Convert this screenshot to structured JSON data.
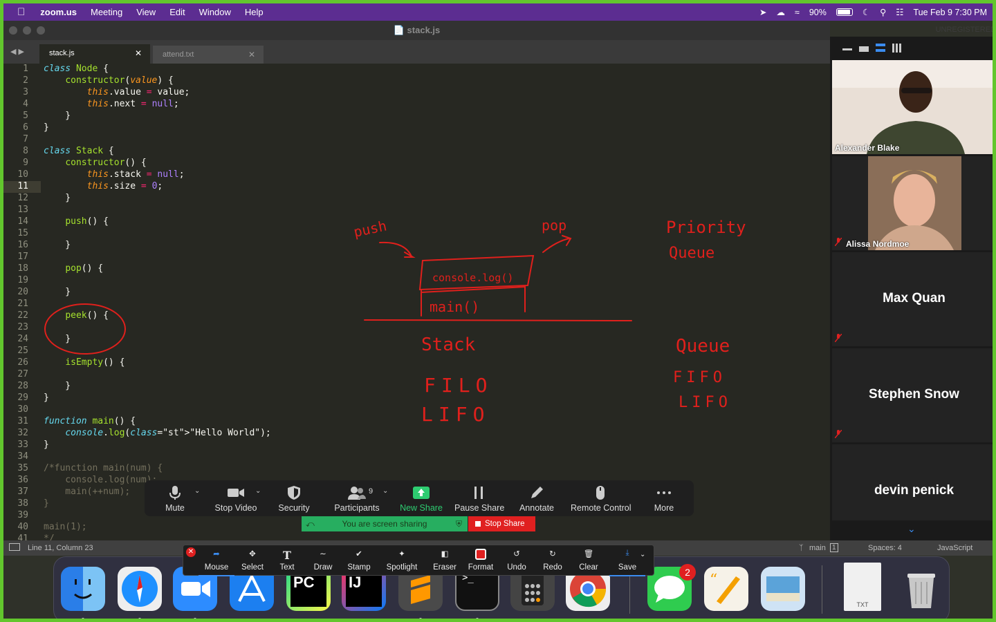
{
  "menubar": {
    "app": "zoom.us",
    "items": [
      "Meeting",
      "View",
      "Edit",
      "Window",
      "Help"
    ],
    "battery": "90%",
    "datetime": "Tue Feb 9  7:30 PM"
  },
  "window": {
    "title": "stack.js",
    "unregistered": "UNREGISTERED"
  },
  "tabs": [
    {
      "label": "stack.js",
      "active": true
    },
    {
      "label": "attend.txt",
      "active": false
    }
  ],
  "editor": {
    "line_numbers": [
      "1",
      "2",
      "3",
      "4",
      "5",
      "6",
      "7",
      "8",
      "9",
      "10",
      "11",
      "12",
      "13",
      "14",
      "15",
      "16",
      "17",
      "18",
      "19",
      "20",
      "21",
      "22",
      "23",
      "24",
      "25",
      "26",
      "27",
      "28",
      "29",
      "30",
      "31",
      "32",
      "33",
      "34",
      "35",
      "36",
      "37",
      "38",
      "39",
      "40",
      "41"
    ],
    "lines": [
      "class Node {",
      "    constructor(value) {",
      "        this.value = value;",
      "        this.next = null;",
      "    }",
      "}",
      "",
      "class Stack {",
      "    constructor() {",
      "        this.stack = null;",
      "        this.size = 0;",
      "    }",
      "",
      "    push() {",
      "",
      "    }",
      "",
      "    pop() {",
      "",
      "    }",
      "",
      "    peek() {",
      "",
      "    }",
      "",
      "    isEmpty() {",
      "",
      "    }",
      "}",
      "",
      "function main() {",
      "    console.log(\"Hello World\");",
      "}",
      "",
      "/*function main(num) {",
      "    console.log(num);",
      "    main(++num);",
      "}",
      "",
      "main(1);",
      "*/"
    ],
    "current_line": 11
  },
  "statusbar": {
    "position": "Line 11, Column 23",
    "branch": "main",
    "branch_count": "1",
    "spaces": "Spaces: 4",
    "syntax": "JavaScript"
  },
  "participants": [
    {
      "name": "Alexander Blake",
      "video": true,
      "muted": false
    },
    {
      "name": "Alissa Nordmoe",
      "video": true,
      "muted": true
    },
    {
      "name": "Max Quan",
      "video": false,
      "muted": true
    },
    {
      "name": "Stephen Snow",
      "video": false,
      "muted": true
    },
    {
      "name": "devin penick",
      "video": false,
      "muted": true
    }
  ],
  "zoom_toolbar": {
    "items": [
      {
        "key": "mute",
        "label": "Mute",
        "icon": "microphone-icon"
      },
      {
        "key": "video",
        "label": "Stop Video",
        "icon": "video-camera-icon"
      },
      {
        "key": "security",
        "label": "Security",
        "icon": "shield-icon"
      },
      {
        "key": "participants",
        "label": "Participants",
        "icon": "participants-icon",
        "count": "9"
      },
      {
        "key": "newshare",
        "label": "New Share",
        "icon": "share-up-arrow-icon",
        "accent": "#2ecc71"
      },
      {
        "key": "pause",
        "label": "Pause Share",
        "icon": "pause-icon"
      },
      {
        "key": "annotate",
        "label": "Annotate",
        "icon": "pencil-icon"
      },
      {
        "key": "remote",
        "label": "Remote Control",
        "icon": "mouse-icon"
      },
      {
        "key": "more",
        "label": "More",
        "icon": "more-dots-icon"
      }
    ]
  },
  "sharebar": {
    "status": "You are screen sharing",
    "stop": "Stop Share"
  },
  "annotation_toolbar": {
    "items": [
      "Mouse",
      "Select",
      "Text",
      "Draw",
      "Stamp",
      "Spotlight",
      "Eraser",
      "Format",
      "Undo",
      "Redo",
      "Clear",
      "Save"
    ],
    "active": "Mouse"
  },
  "whiteboard_text": {
    "push": "push",
    "pop": "pop",
    "box_top": "console.log()",
    "box_bottom": "main()",
    "stack": "Stack",
    "filo": "FILO",
    "lifo": "LIFO",
    "priority": "Priority",
    "queue_small": "Queue",
    "queue": "Queue",
    "fifo": "FIFO",
    "lifo2": "LIFO"
  },
  "dock": {
    "messages_badge": "2",
    "txt_label": "TXT",
    "apps": [
      "finder-icon",
      "safari-icon",
      "zoom-icon",
      "xcode-icon",
      "pycharm-icon",
      "intellij-icon",
      "sublime-text-icon",
      "terminal-icon",
      "calculator-icon",
      "chrome-icon",
      "messages-icon",
      "pages-icon",
      "preview-icon",
      "text-file-icon",
      "trash-icon"
    ]
  },
  "colors": {
    "accent_menubar": "#5c2d91",
    "frame_border": "#62c62d",
    "annotation_red": "#e0201c",
    "share_green": "#27ae60",
    "stop_red": "#e02020"
  }
}
